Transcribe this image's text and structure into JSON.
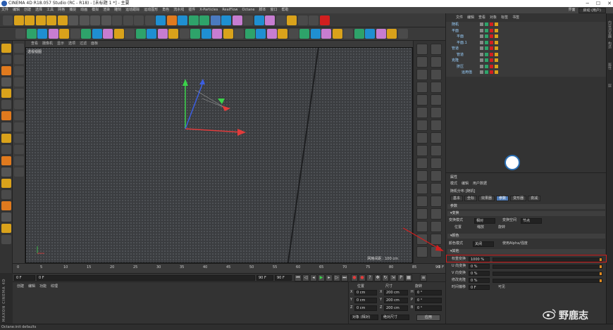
{
  "window": {
    "title": "CINEMA 4D R18.057 Studio (RC - R18) - [未标题 1 *] - 主要"
  },
  "menu": {
    "items": [
      "文件",
      "编辑",
      "创建",
      "选择",
      "工具",
      "网格",
      "捕捉",
      "动画",
      "模拟",
      "渲染",
      "雕刻",
      "运动跟踪",
      "运动图形",
      "角色",
      "流水线",
      "插件",
      "X-Particles",
      "RealFlow",
      "Octane",
      "脚本",
      "窗口",
      "帮助"
    ],
    "layout_label": "界面",
    "layout_value": "启动 (用户)"
  },
  "viewport": {
    "menu": [
      "查看",
      "摄像机",
      "显示",
      "选项",
      "过滤",
      "面板"
    ],
    "label": "透视视图",
    "status": "网格间距 : 100 cm"
  },
  "timeline": {
    "ticks": [
      "0",
      "5",
      "10",
      "15",
      "20",
      "25",
      "30",
      "35",
      "40",
      "45",
      "50",
      "55",
      "60",
      "65",
      "70",
      "75",
      "80",
      "85",
      "90"
    ],
    "end": "0 F"
  },
  "transport": {
    "start": "0 F",
    "current": "0 F",
    "end_field": "90 F",
    "end_field2": "90 F"
  },
  "material_panel": {
    "tabs": [
      "创建",
      "编辑",
      "功能",
      "纹理"
    ]
  },
  "brand_vertical": "MAXON CINEMA 4D",
  "coords": {
    "headers": [
      "位置",
      "尺寸",
      "旋转"
    ],
    "rows": [
      {
        "axis": "X",
        "pos": "0 cm",
        "size": "200 cm",
        "rot_label": "H",
        "rot": "0 °"
      },
      {
        "axis": "Y",
        "pos": "0 cm",
        "size": "200 cm",
        "rot_label": "P",
        "rot": "0 °"
      },
      {
        "axis": "Z",
        "pos": "0 cm",
        "size": "200 cm",
        "rot_label": "B",
        "rot": "0 °"
      }
    ],
    "mode": "对象 (相对)",
    "size_mode": "绝对尺寸",
    "apply": "应用"
  },
  "status": {
    "text": "Octane:init defaults"
  },
  "objects": {
    "menu": [
      "文件",
      "编辑",
      "查看",
      "对象",
      "标签",
      "书签"
    ],
    "rows": [
      {
        "name": "随机",
        "indent": 0
      },
      {
        "name": "平面",
        "indent": 0
      },
      {
        "name": "平面",
        "indent": 1
      },
      {
        "name": "平面.1",
        "indent": 1
      },
      {
        "name": "管道",
        "indent": 0
      },
      {
        "name": "管道",
        "indent": 1
      },
      {
        "name": "克隆",
        "indent": 0
      },
      {
        "name": "挤压",
        "indent": 1
      },
      {
        "name": "运用值",
        "indent": 2
      }
    ]
  },
  "attributes": {
    "title": "属性",
    "menu": [
      "模式",
      "编辑",
      "用户数据"
    ],
    "object": "随机分布 [随机]",
    "tabs": [
      "基本",
      "坐标",
      "效果器",
      "参数",
      "变形器",
      "衰减"
    ],
    "active_tab": "参数",
    "section_param": "参数",
    "section_transform": "▾变换",
    "transform_mode_label": "变换模式",
    "transform_mode": "相对",
    "transform_space_label": "变换空间",
    "transform_space": "节点",
    "check_pos": "位置",
    "check_scale": "缩放",
    "check_rot": "旋转",
    "section_color": "▾颜色",
    "color_mode_label": "颜色模式",
    "color_mode": "关闭",
    "use_alpha": "使用Alpha/强度",
    "section_other": "▾其他",
    "rows": [
      {
        "label": "权重变换",
        "value": "1000 %",
        "fill": 1.0
      },
      {
        "label": "U 向变换",
        "value": "0 %",
        "fill": 0
      },
      {
        "label": "V 向变换",
        "value": "0 %",
        "fill": 0
      },
      {
        "label": "修改克隆",
        "value": "0 %",
        "fill": 0
      },
      {
        "label": "时间偏移",
        "value": "0 F",
        "extra": "可见"
      }
    ]
  },
  "sidestrip": [
    "内容浏览器",
    "构造",
    "属性",
    "层"
  ],
  "watermark": "野鹿志",
  "colors": {
    "accent": "#4e7ab5",
    "highlight": "#d21f1f",
    "slider_fill": "#e08a1e",
    "axis_x": "#e23b3b",
    "axis_y": "#3bd34a",
    "axis_z": "#3b5ee2"
  }
}
